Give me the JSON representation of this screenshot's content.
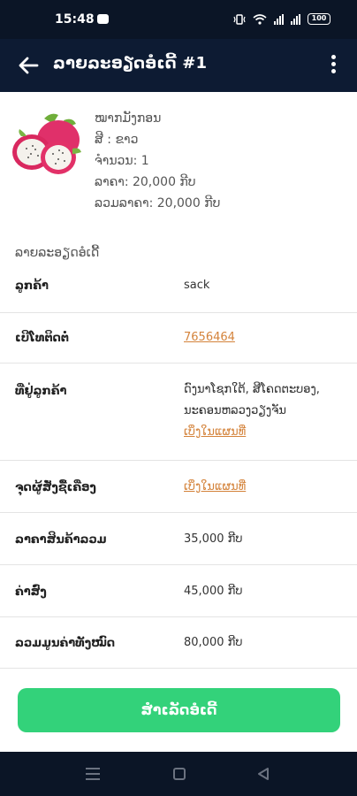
{
  "status": {
    "time": "15:48",
    "battery": "100"
  },
  "header": {
    "title": "ລາຍລະອຽດອໍເດີ້ #1"
  },
  "product": {
    "name": "ໝາກມັງກອນ",
    "color": "ສີ : ຂາວ",
    "quantity": "ຈຳນວນ: 1",
    "price": "ລາຄາ: 20,000 ກີບ",
    "total": "ລວມລາຄາ: 20,000 ກີບ"
  },
  "details": {
    "section_title": "ລາຍລະອຽດອໍເດີ້",
    "customer_label": "ລູກຄ້າ",
    "customer_value": "sack",
    "phone_label": "ເບີໂທຕິດຕໍ່",
    "phone_value": "7656464",
    "address_label": "ທີ່ຢູ່ລູກຄ້າ",
    "address_line1": "ດົງນາໂຊກໃຕ້, ສີໂຄດຕະບອງ,",
    "address_line2": "ນະຄອນຫລວງວຽງຈັນ",
    "address_map_link": "ເບິ່ງໃນແຜນທີ່",
    "pickup_label": "ຈຸດຜູ້ສັ່ງຊື້ເຄື່ອງ",
    "pickup_map_link": "ເບິ່ງໃນແຜນທີ່",
    "subtotal_label": "ລາຄາສິນຄ້າລວມ",
    "subtotal_value": "35,000 ກີບ",
    "delivery_label": "ຄ່າສົ່ງ",
    "delivery_value": "45,000 ກີບ",
    "grand_total_label": "ລວມມູນຄ່າທັງໝົດ",
    "grand_total_value": "80,000 ກີບ"
  },
  "actions": {
    "complete_label": "ສຳເລັດອໍເດີ້"
  },
  "colors": {
    "header_bg": "#0d1b33",
    "accent_green": "#33d27a",
    "link_orange": "#d4833b"
  },
  "icons": [
    "back-arrow-icon",
    "more-vert-icon",
    "wifi-icon",
    "signal-icon",
    "battery-icon"
  ]
}
